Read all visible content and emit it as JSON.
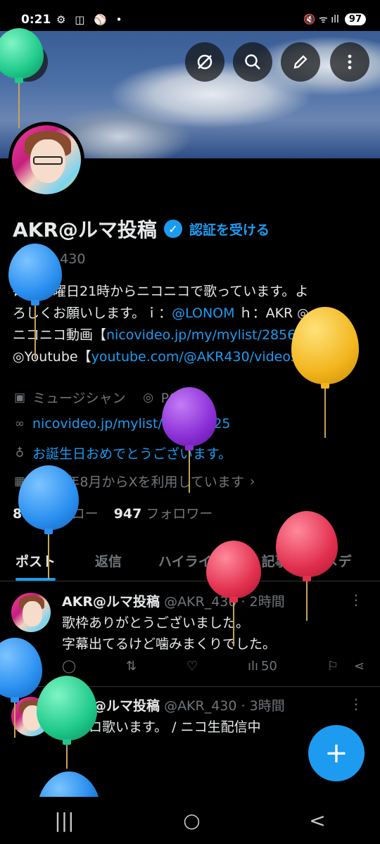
{
  "status_bar": {
    "time": "0:21",
    "left_icons": "⚙ ◫ ⚾ •",
    "right_icons": "🔇 ᯤ ıll",
    "battery": "97"
  },
  "banner": {
    "back_icon": "arrow-left-icon",
    "buttons": [
      "grok-icon",
      "search-icon",
      "edit-icon",
      "more-vertical-icon"
    ]
  },
  "profile": {
    "display_name": "AKR@ルマ投稿",
    "get_verified": "認証を受ける",
    "handle": "@AKR_430",
    "bio_line1": "毎週水曜日21時からニコニコで歌っています。よ",
    "bio_line2_prefix": "ろしくお願いします。ｉ：",
    "bio_line2_link": "@LONOM",
    "bio_line2_suffix": " ｈ：AKR ◎",
    "bio_line3_prefix": "ニコニコ動画【",
    "bio_line3_link": "nicovideo.jp/my/mylist/2856…",
    "bio_line3_suffix": "】",
    "bio_line4_prefix": "◎Youtube【",
    "bio_line4_link": "youtube.com/@AKR430/videos",
    "bio_line4_suffix": "】",
    "category": "ミュージシャン",
    "location": "PCの前",
    "website": "nicovideo.jp/mylist/28564225",
    "birthday": "お誕生日おめでとうございます。",
    "joined": "2010年8月からXを利用しています",
    "following_count": "870",
    "following_label": "フォロー",
    "followers_count": "947",
    "followers_label": "フォロワー"
  },
  "tabs": [
    "ポスト",
    "返信",
    "ハイライト",
    "記事",
    "メデ"
  ],
  "posts": [
    {
      "author": "AKR@ルマ投稿",
      "meta": "@AKR_430 · 2時間",
      "text_line1": "歌枠ありがとうございました。",
      "text_line2": "字幕出てるけど噛みまくりでした。",
      "views": "50"
    },
    {
      "author": "AKR@ルマ投稿",
      "meta": "@AKR_430 · 3時間",
      "text_line1": "ボカロ歌います。 / ニコ生配信中"
    }
  ],
  "fab_label": "+",
  "nav": [
    "|||",
    "○",
    "<"
  ],
  "colors": {
    "accent": "#1d9bf0",
    "background": "#000000",
    "muted": "#71767b"
  }
}
